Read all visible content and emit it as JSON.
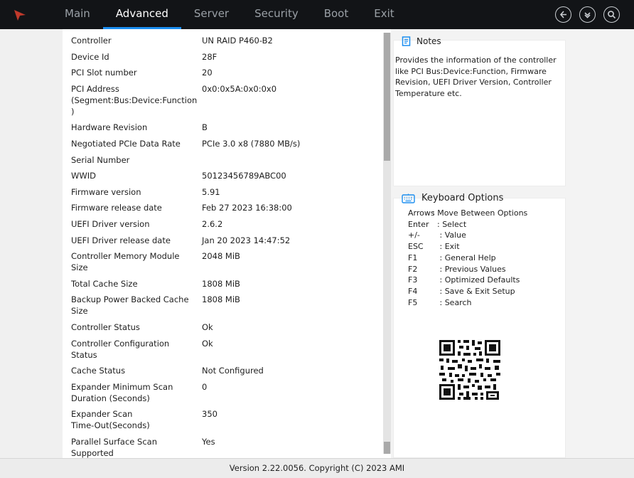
{
  "nav": {
    "tabs": [
      {
        "label": "Main"
      },
      {
        "label": "Advanced"
      },
      {
        "label": "Server"
      },
      {
        "label": "Security"
      },
      {
        "label": "Boot"
      },
      {
        "label": "Exit"
      }
    ],
    "active_tab": "Advanced",
    "icons": [
      "back-icon",
      "save-download-icon",
      "search-icon"
    ],
    "accent_color": "#1b8ef0",
    "logo_color": "#c0392b"
  },
  "rows": [
    {
      "label": "Controller",
      "value": "UN RAID P460-B2"
    },
    {
      "label": "Device Id",
      "value": "28F"
    },
    {
      "label": "PCI Slot number",
      "value": "20"
    },
    {
      "label": "PCI Address\n(Segment:Bus:Device:Function\n)",
      "value": "0x0:0x5A:0x0:0x0"
    },
    {
      "label": "Hardware Revision",
      "value": "B"
    },
    {
      "label": "Negotiated PCIe Data Rate",
      "value": "PCIe 3.0 x8 (7880 MB/s)"
    },
    {
      "label": "Serial Number",
      "value": ""
    },
    {
      "label": "WWID",
      "value": "50123456789ABC00"
    },
    {
      "label": "Firmware version",
      "value": "5.91"
    },
    {
      "label": "Firmware release date",
      "value": "Feb 27 2023 16:38:00"
    },
    {
      "label": "UEFI Driver version",
      "value": "2.6.2"
    },
    {
      "label": "UEFI Driver release date",
      "value": "Jan 20 2023 14:47:52"
    },
    {
      "label": "Controller Memory Module\nSize",
      "value": "2048 MiB"
    },
    {
      "label": "Total Cache Size",
      "value": "1808 MiB"
    },
    {
      "label": "Backup Power Backed Cache\nSize",
      "value": "1808 MiB"
    },
    {
      "label": "Controller Status",
      "value": "Ok"
    },
    {
      "label": "Controller Configuration\nStatus",
      "value": "Ok"
    },
    {
      "label": "Cache Status",
      "value": "Not Configured"
    },
    {
      "label": "Expander Minimum Scan\nDuration (Seconds)",
      "value": "0"
    },
    {
      "label": "Expander Scan\nTime-Out(Seconds)",
      "value": "350"
    },
    {
      "label": "Parallel Surface Scan\nSupported",
      "value": "Yes"
    }
  ],
  "notes": {
    "title": "Notes",
    "text": "Provides the information of the controller like PCI Bus:Device:Function, Firmware Revision, UEFI Driver Version, Controller Temperature etc."
  },
  "keyboard": {
    "title": "Keyboard Options",
    "items": [
      {
        "key": "Arrows",
        "desc": ": Move Between Options"
      },
      {
        "key": "Enter",
        "desc": "  : Select"
      },
      {
        "key": "+/-",
        "desc": "   : Value"
      },
      {
        "key": "ESC",
        "desc": "   : Exit"
      },
      {
        "key": "F1",
        "desc": "   : General Help"
      },
      {
        "key": "F2",
        "desc": "   : Previous Values"
      },
      {
        "key": "F3",
        "desc": "   : Optimized Defaults"
      },
      {
        "key": "F4",
        "desc": "   : Save & Exit Setup"
      },
      {
        "key": "F5",
        "desc": "   : Search"
      }
    ]
  },
  "footer": {
    "text": "Version 2.22.0056. Copyright (C) 2023 AMI"
  }
}
